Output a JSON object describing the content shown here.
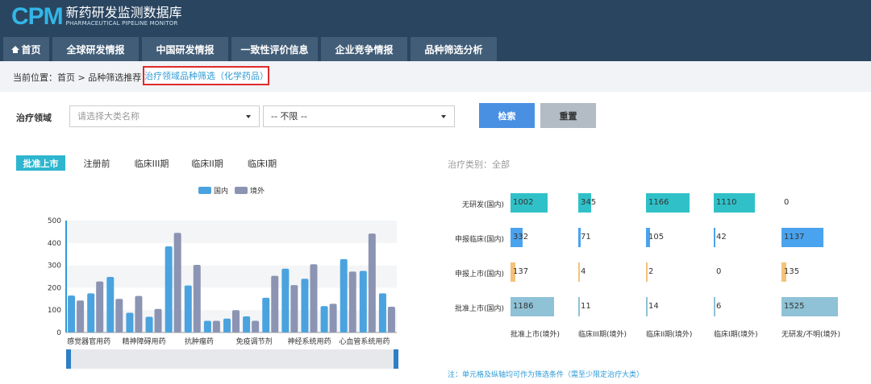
{
  "header": {
    "logo_mark": "CPM",
    "logo_cn": "新药研发监测数据库",
    "logo_en": "PHARMACEUTICAL PIPELINE MONITOR"
  },
  "nav": [
    {
      "label": "首页",
      "icon": "home-icon"
    },
    {
      "label": "全球研发情报"
    },
    {
      "label": "中国研发情报"
    },
    {
      "label": "一致性评价信息"
    },
    {
      "label": "企业竞争情报"
    },
    {
      "label": "品种筛选分析"
    }
  ],
  "breadcrumb": {
    "prefix": "当前位置：首页 > 品种筛选推荐 >",
    "current": "治疗领域品种筛选（化学药品）"
  },
  "filters": {
    "label": "治疗领域",
    "select1_placeholder": "请选择大类名称",
    "select2_value": "-- 不限 --",
    "search_label": "检索",
    "reset_label": "重置"
  },
  "tabs": [
    "批准上市",
    "注册前",
    "临床III期",
    "临床II期",
    "临床I期"
  ],
  "active_tab": 0,
  "category": {
    "label": "治疗类别：",
    "value": "全部"
  },
  "note": "注：单元格及纵轴均可作为筛选条件（需至少限定治疗大类）",
  "colors": {
    "domestic": "#4aa3df",
    "foreign": "#8c94b3",
    "teal": "#30c1c8",
    "blue": "#4aa3ee",
    "orange": "#f4c27a",
    "lightblue": "#8fc2d6",
    "accent": "#2eb5cf"
  },
  "chart_data": {
    "type": "bar",
    "legend": [
      "国内",
      "境外"
    ],
    "ylim": [
      0,
      500
    ],
    "yticks": [
      0,
      100,
      200,
      300,
      400,
      500
    ],
    "x_tick_labels": [
      "感觉器官用药",
      "精神障碍用药",
      "抗肿瘤药",
      "免疫调节剂",
      "神经系统用药",
      "心血管系统用药"
    ],
    "series": [
      {
        "name": "国内",
        "values": [
          165,
          175,
          248,
          88,
          70,
          385,
          210,
          52,
          62,
          72,
          155,
          285,
          240,
          118,
          328,
          275,
          175
        ]
      },
      {
        "name": "境外",
        "values": [
          143,
          228,
          150,
          163,
          105,
          445,
          302,
          52,
          100,
          52,
          253,
          212,
          305,
          128,
          272,
          442,
          115
        ]
      }
    ]
  },
  "matrix": {
    "rows": [
      "无研发(国内)",
      "申报临床(国内)",
      "申报上市(国内)",
      "批准上市(国内)"
    ],
    "cols": [
      "批准上市(境外)",
      "临床III期(境外)",
      "临床II期(境外)",
      "临床I期(境外)",
      "无研发/不明(境外)"
    ],
    "max": 1525,
    "cells": [
      [
        {
          "v": "1002",
          "n": 1002,
          "c": "teal"
        },
        {
          "v": "345",
          "n": 345,
          "c": "teal"
        },
        {
          "v": "1166",
          "n": 1166,
          "c": "teal"
        },
        {
          "v": "1110",
          "n": 1110,
          "c": "teal"
        },
        {
          "v": "0",
          "n": 0,
          "c": "teal"
        }
      ],
      [
        {
          "v": "332",
          "n": 332,
          "c": "blue"
        },
        {
          "v": "71",
          "n": 71,
          "c": "blue"
        },
        {
          "v": "105",
          "n": 105,
          "c": "blue"
        },
        {
          "v": "42",
          "n": 42,
          "c": "blue"
        },
        {
          "v": "1137",
          "n": 1137,
          "c": "blue"
        }
      ],
      [
        {
          "v": "137",
          "n": 137,
          "c": "orange"
        },
        {
          "v": "4",
          "n": 4,
          "c": "orange"
        },
        {
          "v": "2",
          "n": 2,
          "c": "orange"
        },
        {
          "v": "0",
          "n": 0,
          "c": "orange"
        },
        {
          "v": "135",
          "n": 135,
          "c": "orange"
        }
      ],
      [
        {
          "v": "1186",
          "n": 1186,
          "c": "lightblue"
        },
        {
          "v": "11",
          "n": 11,
          "c": "lightblue"
        },
        {
          "v": "14",
          "n": 14,
          "c": "lightblue"
        },
        {
          "v": "6",
          "n": 6,
          "c": "lightblue"
        },
        {
          "v": "1525",
          "n": 1525,
          "c": "lightblue"
        }
      ]
    ]
  }
}
